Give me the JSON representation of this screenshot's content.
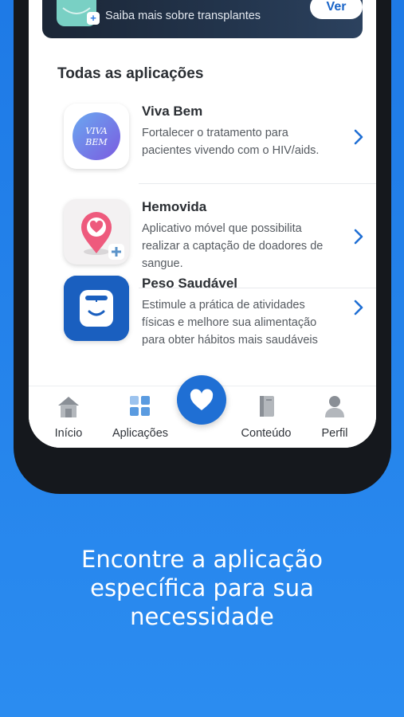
{
  "banner": {
    "subtitle": "Saiba mais sobre transplantes",
    "button_label": "Ver"
  },
  "section": {
    "title": "Todas as aplicações"
  },
  "apps": [
    {
      "name": "Viva Bem",
      "description": "Fortalecer o tratamento para pacientes vivendo com o HIV/aids.",
      "icon_text": "VIVA BEM",
      "icon": "viva-bem-logo"
    },
    {
      "name": "Hemovida",
      "description": "Aplicativo móvel que possibilita realizar a captação de doadores de sangue.",
      "icon": "heart-location-pin"
    },
    {
      "name": "Peso Saudável",
      "description": "Estimule a prática de atividades físicas e melhore sua alimentação para obter hábitos mais saudáveis",
      "icon": "scale-face"
    }
  ],
  "tabs": [
    {
      "label": "Início",
      "icon": "home-icon"
    },
    {
      "label": "Aplicações",
      "icon": "apps-grid-icon"
    },
    {
      "label": "Conteúdo",
      "icon": "book-icon"
    },
    {
      "label": "Perfil",
      "icon": "user-icon"
    }
  ],
  "center_button": {
    "icon": "heart-icon"
  },
  "caption": {
    "line1": "Encontre a aplicação",
    "line2": "específica para sua",
    "line3": "necessidade"
  },
  "colors": {
    "background": "#1e7ae6",
    "accent": "#1f6fd4",
    "tab_active_icon": "#5a9be0"
  }
}
